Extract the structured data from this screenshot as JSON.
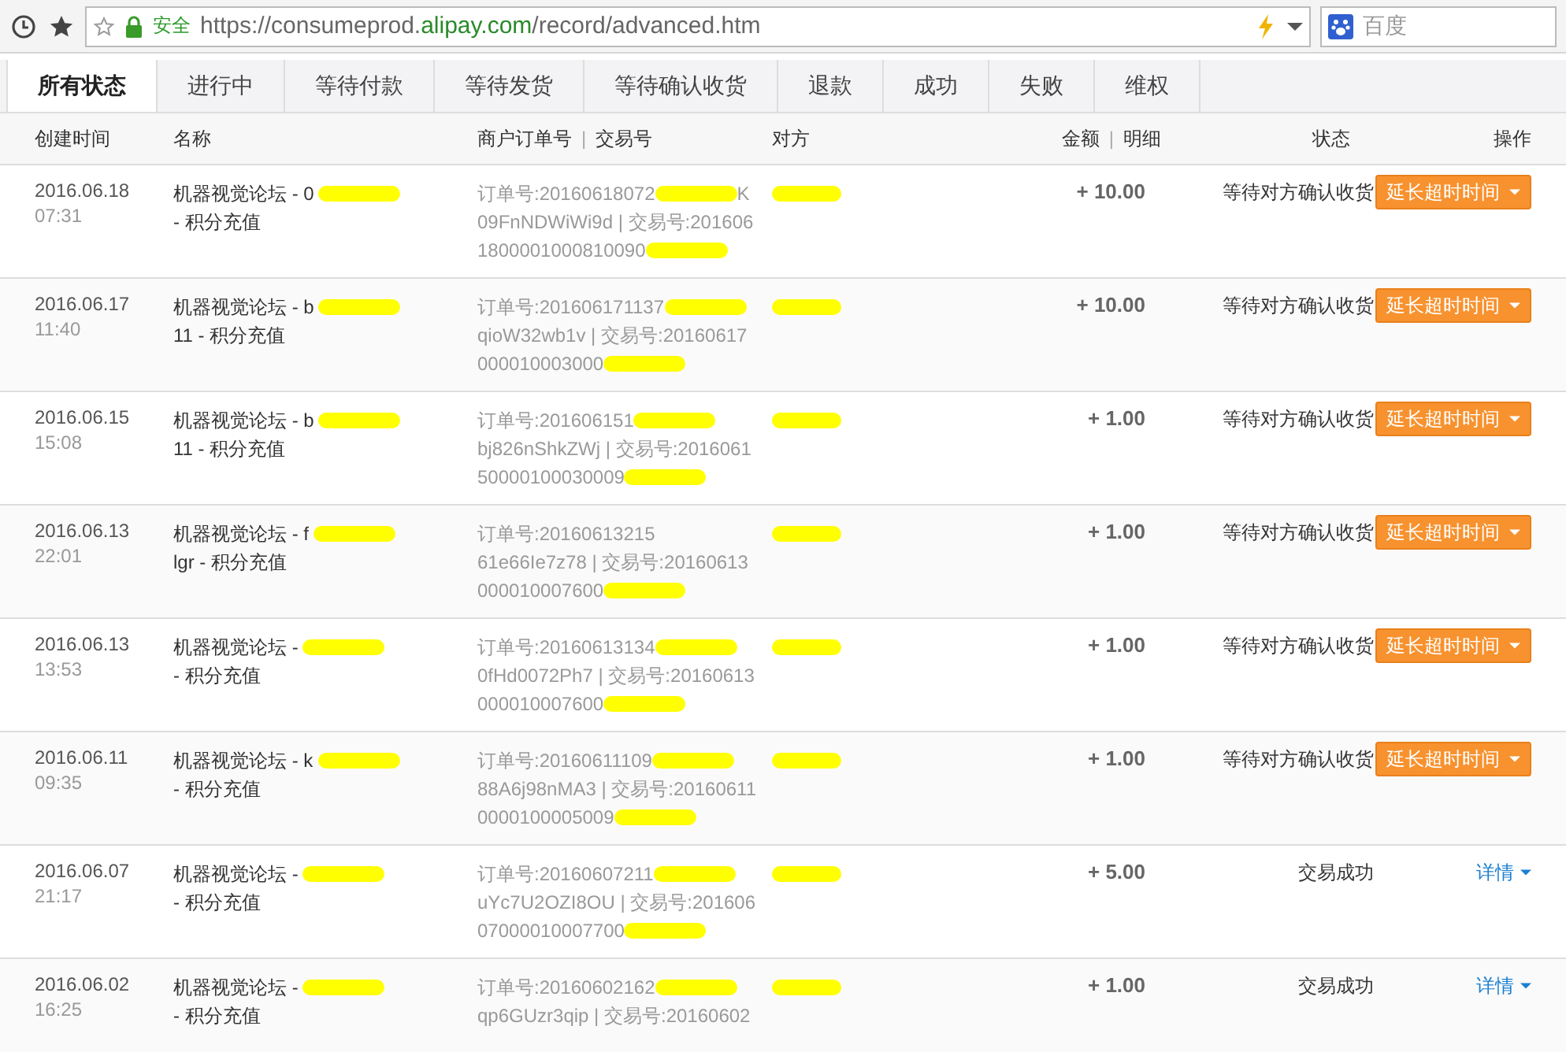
{
  "browser": {
    "secure_label": "安全",
    "url_prefix": "https://consumeprod.",
    "url_domain": "alipay.com",
    "url_suffix": "/record/advanced.htm",
    "search_placeholder": "百度"
  },
  "tabs": [
    {
      "label": "所有状态",
      "selected": true
    },
    {
      "label": "进行中",
      "selected": false
    },
    {
      "label": "等待付款",
      "selected": false
    },
    {
      "label": "等待发货",
      "selected": false
    },
    {
      "label": "等待确认收货",
      "selected": false
    },
    {
      "label": "退款",
      "selected": false
    },
    {
      "label": "成功",
      "selected": false
    },
    {
      "label": "失败",
      "selected": false
    },
    {
      "label": "维权",
      "selected": false
    }
  ],
  "columns": {
    "created": "创建时间",
    "name": "名称",
    "order": "商户订单号",
    "order_sep": "|",
    "trade": "交易号",
    "party": "对方",
    "amount": "金额",
    "amount_sep": "|",
    "detail": "明细",
    "status": "状态",
    "action": "操作"
  },
  "rows": [
    {
      "date": "2016.06.18",
      "time": "07:31",
      "name": [
        {
          "kind": "text",
          "text": "机器视觉论坛 - 0"
        },
        {
          "kind": "redaction"
        },
        {
          "kind": "text",
          "text": "- 积分充值"
        }
      ],
      "order_lines": [
        [
          {
            "kind": "text",
            "text": "订单号:20160618072"
          },
          {
            "kind": "redaction"
          },
          {
            "kind": "text",
            "text": "K"
          }
        ],
        [
          {
            "kind": "text",
            "text": "09FnNDWiWi9d | 交易号:201606"
          }
        ],
        [
          {
            "kind": "text",
            "text": "1800001000810090"
          },
          {
            "kind": "redaction"
          }
        ]
      ],
      "party": [
        {
          "kind": "redaction"
        }
      ],
      "amount": "+ 10.00",
      "status": "等待对方确认收货",
      "action": {
        "kind": "extend",
        "label": "延长超时时间"
      }
    },
    {
      "date": "2016.06.17",
      "time": "11:40",
      "name": [
        {
          "kind": "text",
          "text": "机器视觉论坛 - b"
        },
        {
          "kind": "redaction"
        },
        {
          "kind": "text",
          "text": "11 - 积分充值"
        }
      ],
      "order_lines": [
        [
          {
            "kind": "text",
            "text": "订单号:201606171137"
          },
          {
            "kind": "redaction"
          }
        ],
        [
          {
            "kind": "text",
            "text": "qioW32wb1v | 交易号:20160617"
          }
        ],
        [
          {
            "kind": "text",
            "text": "000010003000"
          },
          {
            "kind": "redaction"
          }
        ]
      ],
      "party": [
        {
          "kind": "redaction"
        }
      ],
      "amount": "+ 10.00",
      "status": "等待对方确认收货",
      "action": {
        "kind": "extend",
        "label": "延长超时时间"
      }
    },
    {
      "date": "2016.06.15",
      "time": "15:08",
      "name": [
        {
          "kind": "text",
          "text": "机器视觉论坛 - b"
        },
        {
          "kind": "redaction"
        },
        {
          "kind": "text",
          "text": "11 - 积分充值"
        }
      ],
      "order_lines": [
        [
          {
            "kind": "text",
            "text": "订单号:201606151"
          },
          {
            "kind": "redaction"
          }
        ],
        [
          {
            "kind": "text",
            "text": "bj826nShkZWj | 交易号:2016061"
          }
        ],
        [
          {
            "kind": "text",
            "text": "50000100030009"
          },
          {
            "kind": "redaction"
          }
        ]
      ],
      "party": [
        {
          "kind": "redaction"
        }
      ],
      "amount": "+ 1.00",
      "status": "等待对方确认收货",
      "action": {
        "kind": "extend",
        "label": "延长超时时间"
      }
    },
    {
      "date": "2016.06.13",
      "time": "22:01",
      "name": [
        {
          "kind": "text",
          "text": "机器视觉论坛 - f"
        },
        {
          "kind": "redaction"
        },
        {
          "kind": "text",
          "text": "lgr - 积分充值"
        }
      ],
      "order_lines": [
        [
          {
            "kind": "text",
            "text": "订单号:20160613215"
          }
        ],
        [
          {
            "kind": "text",
            "text": "61e66Ie7z78 | 交易号:20160613"
          }
        ],
        [
          {
            "kind": "text",
            "text": "000010007600"
          },
          {
            "kind": "redaction"
          }
        ]
      ],
      "party": [
        {
          "kind": "redaction"
        }
      ],
      "amount": "+ 1.00",
      "status": "等待对方确认收货",
      "action": {
        "kind": "extend",
        "label": "延长超时时间"
      }
    },
    {
      "date": "2016.06.13",
      "time": "13:53",
      "name": [
        {
          "kind": "text",
          "text": "机器视觉论坛 -"
        },
        {
          "kind": "redaction"
        },
        {
          "kind": "text",
          "text": "- 积分充值"
        }
      ],
      "order_lines": [
        [
          {
            "kind": "text",
            "text": "订单号:20160613134"
          },
          {
            "kind": "redaction"
          }
        ],
        [
          {
            "kind": "text",
            "text": "0fHd0072Ph7 | 交易号:20160613"
          }
        ],
        [
          {
            "kind": "text",
            "text": "000010007600"
          },
          {
            "kind": "redaction"
          }
        ]
      ],
      "party": [
        {
          "kind": "redaction"
        }
      ],
      "amount": "+ 1.00",
      "status": "等待对方确认收货",
      "action": {
        "kind": "extend",
        "label": "延长超时时间"
      }
    },
    {
      "date": "2016.06.11",
      "time": "09:35",
      "name": [
        {
          "kind": "text",
          "text": "机器视觉论坛 - k"
        },
        {
          "kind": "redaction"
        },
        {
          "kind": "text",
          "text": "- 积分充值"
        }
      ],
      "order_lines": [
        [
          {
            "kind": "text",
            "text": "订单号:20160611109"
          },
          {
            "kind": "redaction"
          }
        ],
        [
          {
            "kind": "text",
            "text": "88A6j98nMA3 | 交易号:20160611"
          }
        ],
        [
          {
            "kind": "text",
            "text": "0000100005009"
          },
          {
            "kind": "redaction"
          }
        ]
      ],
      "party": [
        {
          "kind": "redaction"
        }
      ],
      "amount": "+ 1.00",
      "status": "等待对方确认收货",
      "action": {
        "kind": "extend",
        "label": "延长超时时间"
      }
    },
    {
      "date": "2016.06.07",
      "time": "21:17",
      "name": [
        {
          "kind": "text",
          "text": "机器视觉论坛 -"
        },
        {
          "kind": "redaction"
        },
        {
          "kind": "text",
          "text": "- 积分充值"
        }
      ],
      "order_lines": [
        [
          {
            "kind": "text",
            "text": "订单号:20160607211"
          },
          {
            "kind": "redaction"
          }
        ],
        [
          {
            "kind": "text",
            "text": "uYc7U2OZI8OU | 交易号:201606"
          }
        ],
        [
          {
            "kind": "text",
            "text": "07000010007700"
          },
          {
            "kind": "redaction"
          }
        ]
      ],
      "party": [
        {
          "kind": "redaction"
        }
      ],
      "amount": "+ 5.00",
      "status": "交易成功",
      "action": {
        "kind": "details",
        "label": "详情"
      }
    },
    {
      "date": "2016.06.02",
      "time": "16:25",
      "name": [
        {
          "kind": "text",
          "text": "机器视觉论坛 -"
        },
        {
          "kind": "redaction"
        },
        {
          "kind": "text",
          "text": "- 积分充值"
        }
      ],
      "order_lines": [
        [
          {
            "kind": "text",
            "text": "订单号:20160602162"
          },
          {
            "kind": "redaction"
          }
        ],
        [
          {
            "kind": "text",
            "text": "qp6GUzr3qip | 交易号:20160602"
          }
        ]
      ],
      "party": [
        {
          "kind": "redaction"
        }
      ],
      "amount": "+ 1.00",
      "status": "交易成功",
      "action": {
        "kind": "details",
        "label": "详情"
      }
    }
  ]
}
